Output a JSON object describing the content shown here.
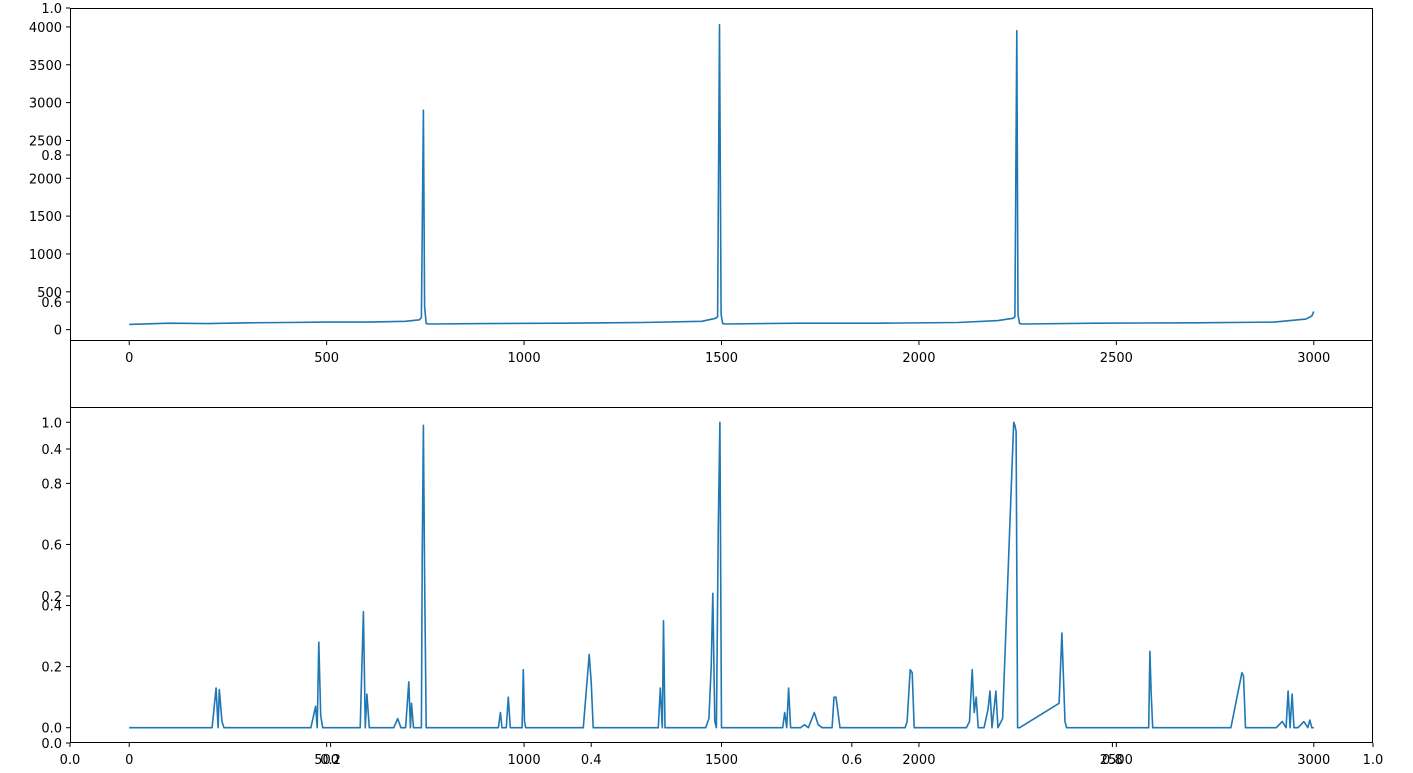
{
  "chart_data": [
    {
      "type": "line",
      "subplot": "top",
      "x_ticks": [
        "0",
        "500",
        "1000",
        "1500",
        "2000",
        "2500",
        "3000"
      ],
      "y_ticks": [
        "0",
        "500",
        "1000",
        "1500",
        "2000",
        "2500",
        "3000",
        "3500",
        "4000"
      ],
      "xlim": [
        -150,
        3150
      ],
      "ylim": [
        -150,
        4250
      ],
      "series": [
        {
          "color": "#1f77b4",
          "x": [
            0,
            100,
            200,
            300,
            400,
            500,
            600,
            700,
            735,
            740,
            745,
            748,
            752,
            760,
            900,
            1100,
            1300,
            1450,
            1485,
            1490,
            1495,
            1499,
            1503,
            1510,
            1700,
            1900,
            2100,
            2200,
            2238,
            2243,
            2248,
            2251,
            2255,
            2262,
            2450,
            2700,
            2900,
            2980,
            2995,
            3000
          ],
          "y": [
            70,
            85,
            80,
            90,
            95,
            100,
            100,
            110,
            130,
            160,
            2900,
            300,
            80,
            75,
            80,
            85,
            95,
            110,
            150,
            170,
            4030,
            200,
            80,
            75,
            85,
            85,
            95,
            120,
            150,
            170,
            3950,
            200,
            80,
            75,
            85,
            90,
            100,
            140,
            180,
            240
          ]
        }
      ]
    },
    {
      "type": "line",
      "subplot": "bottom",
      "x_ticks": [
        "0",
        "500",
        "1000",
        "1500",
        "2000",
        "2500",
        "3000"
      ],
      "y_ticks": [
        "0.0",
        "0.2",
        "0.4",
        "0.6",
        "0.8",
        "1.0"
      ],
      "xlim": [
        -150,
        3150
      ],
      "ylim": [
        -0.05,
        1.05
      ],
      "series": [
        {
          "color": "#1f77b4",
          "x": [
            0,
            210,
            220,
            225,
            228,
            235,
            240,
            460,
            472,
            476,
            480,
            485,
            490,
            585,
            593,
            598,
            602,
            608,
            670,
            680,
            688,
            700,
            708,
            712,
            715,
            720,
            740,
            742,
            745,
            748,
            752,
            935,
            940,
            944,
            955,
            960,
            965,
            995,
            998,
            1001,
            1004,
            1150,
            1165,
            1170,
            1175,
            1178,
            1182,
            1340,
            1345,
            1350,
            1353,
            1357,
            1460,
            1468,
            1474,
            1478,
            1483,
            1487,
            1492,
            1496,
            1500,
            1655,
            1660,
            1665,
            1670,
            1675,
            1700,
            1710,
            1720,
            1735,
            1745,
            1755,
            1780,
            1785,
            1790,
            1795,
            1800,
            1965,
            1970,
            1978,
            1983,
            1988,
            1993,
            2120,
            2128,
            2135,
            2140,
            2145,
            2150,
            2165,
            2175,
            2180,
            2185,
            2195,
            2200,
            2212,
            2240,
            2243,
            2246,
            2250,
            2255,
            2355,
            2362,
            2370,
            2374,
            2378,
            2582,
            2585,
            2588,
            2592,
            2598,
            2790,
            2818,
            2822,
            2827,
            2832,
            2905,
            2920,
            2930,
            2935,
            2940,
            2945,
            2950,
            2960,
            2975,
            2985,
            2990,
            2995,
            3000
          ],
          "y": [
            0,
            0,
            0.13,
            0,
            0.125,
            0.02,
            0,
            0,
            0.07,
            0,
            0.28,
            0.04,
            0,
            0,
            0.38,
            0,
            0.11,
            0,
            0,
            0.03,
            0,
            0,
            0.15,
            0,
            0.08,
            0,
            0,
            0.55,
            0.99,
            0.5,
            0,
            0,
            0.05,
            0,
            0,
            0.1,
            0,
            0,
            0.19,
            0.02,
            0,
            0,
            0.24,
            0.15,
            0,
            0,
            0,
            0,
            0.13,
            0,
            0.35,
            0,
            0,
            0.03,
            0.2,
            0.44,
            0.02,
            0,
            0.66,
            1.0,
            0,
            0,
            0.05,
            0,
            0.13,
            0,
            0,
            0.01,
            0,
            0.05,
            0.01,
            0,
            0,
            0.1,
            0.1,
            0.05,
            0,
            0,
            0.02,
            0.19,
            0.18,
            0,
            0,
            0,
            0.02,
            0.19,
            0.05,
            0.1,
            0,
            0,
            0.06,
            0.12,
            0,
            0.12,
            0,
            0.03,
            1.0,
            0.99,
            0.97,
            0,
            0,
            0.08,
            0.31,
            0.02,
            0,
            0,
            0,
            0.25,
            0.12,
            0,
            0,
            0,
            0.18,
            0.17,
            0,
            0,
            0,
            0.02,
            0,
            0.12,
            0,
            0.11,
            0,
            0,
            0.02,
            0,
            0.025,
            0,
            0
          ]
        }
      ]
    },
    {
      "type": "line",
      "subplot": "background-axes",
      "x_ticks": [
        "0.0",
        "0.2",
        "0.4",
        "0.6",
        "0.8",
        "1.0"
      ],
      "y_ticks": [
        "0.0",
        "0.2",
        "0.4",
        "0.6",
        "0.8",
        "1.0"
      ],
      "xlim": [
        0,
        1
      ],
      "ylim": [
        0,
        1
      ]
    }
  ]
}
